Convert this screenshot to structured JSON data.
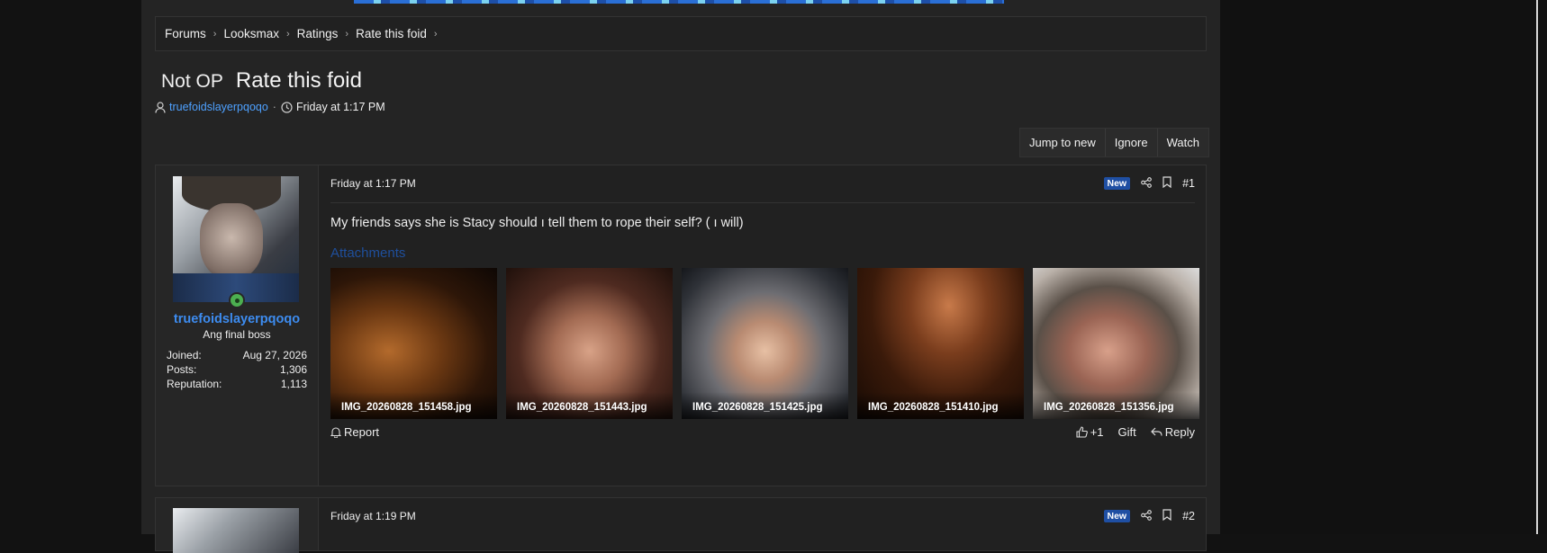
{
  "breadcrumb": [
    "Forums",
    "Looksmax",
    "Ratings",
    "Rate this foid"
  ],
  "thread": {
    "prefix": "Not OP",
    "title": "Rate this foid",
    "author": "truefoidslayerpqoqo",
    "date": "Friday at 1:17 PM"
  },
  "actions": [
    "Jump to new",
    "Ignore",
    "Watch"
  ],
  "posts": [
    {
      "date": "Friday at 1:17 PM",
      "badge": "New",
      "number": "#1",
      "username": "truefoidslayerpqoqo",
      "user_title": "Ang final boss",
      "stats": [
        {
          "label": "Joined:",
          "value": "Aug 27, 2026"
        },
        {
          "label": "Posts:",
          "value": "1,306"
        },
        {
          "label": "Reputation:",
          "value": "1,113"
        }
      ],
      "message": "My friends says she is Stacy should ı tell them to rope their self? ( ı will)",
      "attachments_title": "Attachments",
      "attachments": [
        "IMG_20260828_151458.jpg",
        "IMG_20260828_151443.jpg",
        "IMG_20260828_151425.jpg",
        "IMG_20260828_151410.jpg",
        "IMG_20260828_151356.jpg"
      ],
      "footer": {
        "report": "Report",
        "like": "+1",
        "gift": "Gift",
        "reply": "Reply"
      }
    },
    {
      "date": "Friday at 1:19 PM",
      "badge": "New",
      "number": "#2"
    }
  ],
  "colors": {
    "link": "#4ea1ff",
    "badge": "#1f4fa3",
    "online": "#4caf50"
  }
}
